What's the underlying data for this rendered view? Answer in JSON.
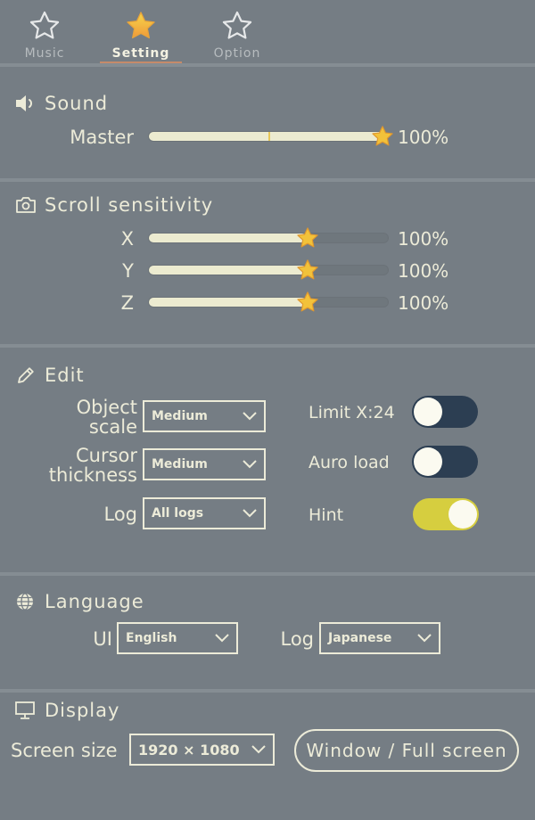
{
  "tabs": [
    {
      "label": "Music",
      "active": false
    },
    {
      "label": "Setting",
      "active": true
    },
    {
      "label": "Option",
      "active": false
    }
  ],
  "sound": {
    "title": "Sound",
    "icon": "speaker-icon",
    "master": {
      "label": "Master",
      "value_text": "100%",
      "level": 1.0
    }
  },
  "scroll": {
    "title": "Scroll sensitivity",
    "icon": "camera-icon",
    "axes": [
      {
        "label": "X",
        "value_text": "100%",
        "level": 0.66
      },
      {
        "label": "Y",
        "value_text": "100%",
        "level": 0.66
      },
      {
        "label": "Z",
        "value_text": "100%",
        "level": 0.66
      }
    ]
  },
  "edit": {
    "title": "Edit",
    "icon": "pencil-icon",
    "object_scale": {
      "label_line1": "Object",
      "label_line2": "scale",
      "value": "Medium"
    },
    "cursor_thickness": {
      "label_line1": "Cursor",
      "label_line2": "thickness",
      "value": "Medium"
    },
    "log": {
      "label": "Log",
      "value": "All logs"
    },
    "limit": {
      "label": "Limit X:24",
      "on": false
    },
    "auto_load": {
      "label": "Auro load",
      "on": false
    },
    "hint": {
      "label": "Hint",
      "on": true
    }
  },
  "language": {
    "title": "Language",
    "icon": "globe-icon",
    "ui": {
      "label": "UI",
      "value": "English"
    },
    "log": {
      "label": "Log",
      "value": "Japanese"
    }
  },
  "display": {
    "title": "Display",
    "icon": "monitor-icon",
    "screen_size": {
      "label": "Screen size",
      "value": "1920 × 1080"
    },
    "mode_button": "Window / Full screen"
  },
  "colors": {
    "background": "#757d84",
    "text": "#ecebd8",
    "slider_fill": "#ecebd0",
    "toggle_off": "#2c3e52",
    "toggle_on": "#d6ce3f",
    "star_active": "#f2c23a"
  }
}
